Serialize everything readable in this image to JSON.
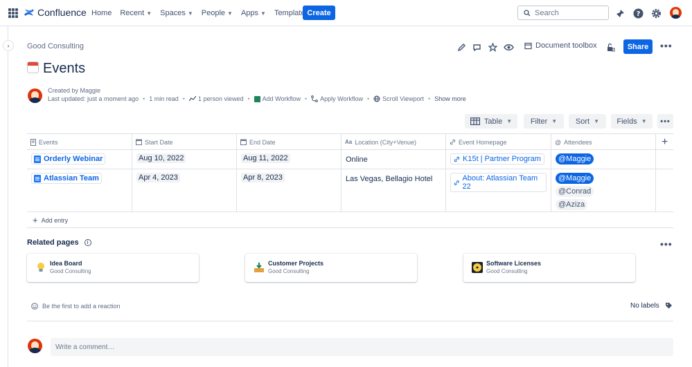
{
  "topbar": {
    "app_name": "Confluence",
    "nav": [
      "Home",
      "Recent",
      "Spaces",
      "People",
      "Apps",
      "Templates"
    ],
    "create_label": "Create",
    "search_placeholder": "Search"
  },
  "breadcrumb": "Good Consulting",
  "page_actions": {
    "document_toolbox": "Document toolbox",
    "share": "Share"
  },
  "page": {
    "title": "Events",
    "created_by": "Created by Maggie",
    "last_updated": "Last updated: just a moment ago",
    "read_time": "1 min read",
    "viewed": "1 person viewed",
    "add_workflow": "Add Workflow",
    "apply_workflow": "Apply Workflow",
    "scroll_viewport": "Scroll Viewport",
    "show_more": "Show more"
  },
  "db_toolbar": {
    "table": "Table",
    "filter": "Filter",
    "sort": "Sort",
    "fields": "Fields"
  },
  "table": {
    "columns": [
      "Events",
      "Start Date",
      "End Date",
      "Location (City+Venue)",
      "Event Homepage",
      "Attendees"
    ],
    "rows": [
      {
        "event": "Orderly Webinar",
        "start": "Aug 10, 2022",
        "end": "Aug 11, 2022",
        "location": "Online",
        "homepage": "K15t | Partner Program",
        "attendees": [
          "@Maggie"
        ]
      },
      {
        "event": "Atlassian Team",
        "start": "Apr 4, 2023",
        "end": "Apr 8, 2023",
        "location": "Las Vegas, Bellagio Hotel",
        "homepage": "About: Atlassian Team 22",
        "attendees": [
          "@Maggie",
          "@Conrad",
          "@Aziza"
        ]
      }
    ],
    "add_entry": "Add entry"
  },
  "related": {
    "title": "Related pages",
    "cards": [
      {
        "title": "Idea Board",
        "space": "Good Consulting",
        "icon": "lightbulb-icon",
        "color": "#f5cd47"
      },
      {
        "title": "Customer Projects",
        "space": "Good Consulting",
        "icon": "inbox-download-icon",
        "color": "#e2a03f"
      },
      {
        "title": "Software Licenses",
        "space": "Good Consulting",
        "icon": "disc-icon",
        "color": "#1d2125"
      }
    ]
  },
  "footer": {
    "reaction": "Be the first to add a reaction",
    "labels": "No labels",
    "comment_placeholder": "Write a comment…"
  }
}
